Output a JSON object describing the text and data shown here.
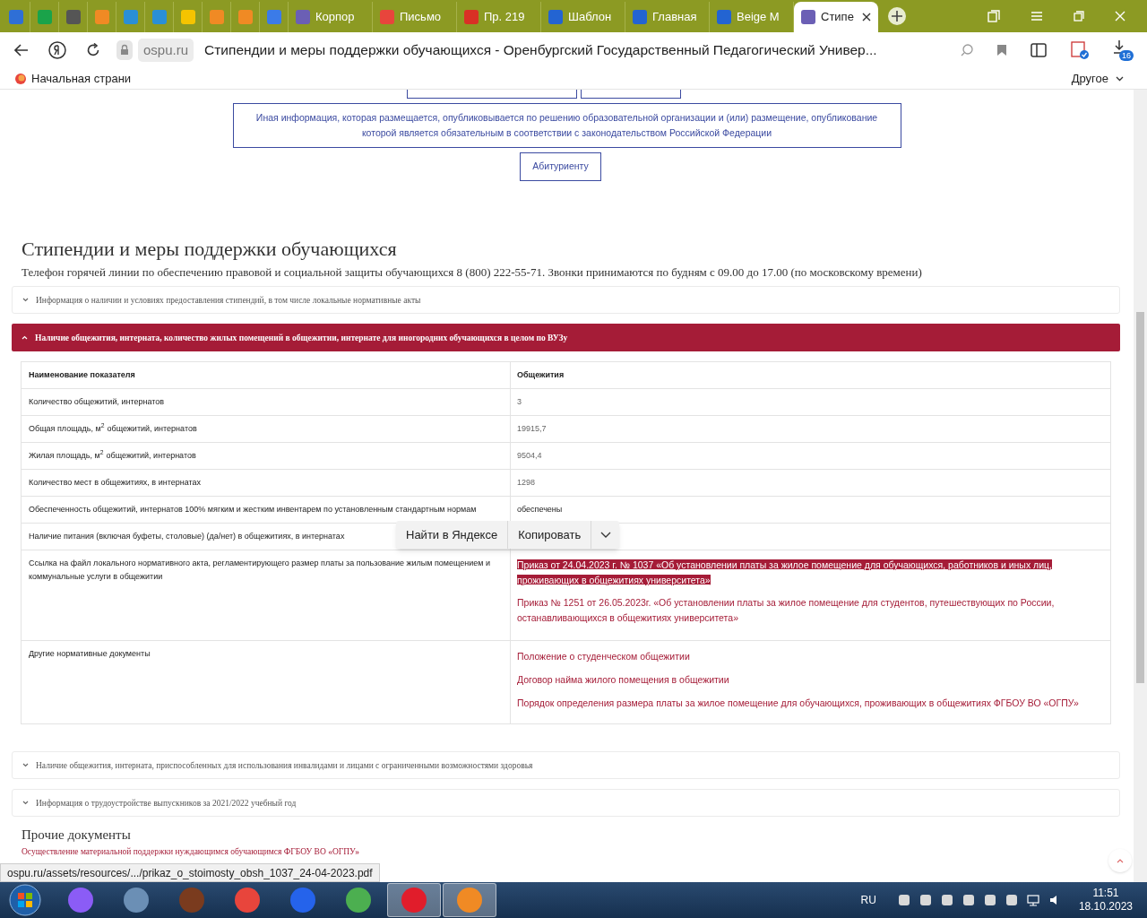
{
  "browser": {
    "tabs": [
      {
        "color": "#2f6fd6",
        "selected": false
      },
      {
        "color": "#1aa34a",
        "selected": false
      },
      {
        "color": "#555555",
        "selected": false
      },
      {
        "color": "#f08a24",
        "selected": false
      },
      {
        "color": "#2a8fd6",
        "selected": false
      },
      {
        "color": "#2a8fd6",
        "selected": false
      },
      {
        "color": "#f5c400",
        "selected": false
      },
      {
        "color": "#f08a24",
        "selected": false
      },
      {
        "color": "#f08a24",
        "selected": false
      },
      {
        "color": "#3b7be8",
        "selected": false
      },
      {
        "label": "Корпор",
        "color": "#6b5fb5",
        "selected": false
      },
      {
        "label": "Письмо",
        "color": "#e8453c",
        "selected": false
      },
      {
        "label": "Пр. 219",
        "color": "#d93025",
        "selected": false
      },
      {
        "label": "Шаблон",
        "color": "#2364d2",
        "selected": false
      },
      {
        "label": "Главная",
        "color": "#2364d2",
        "selected": false
      },
      {
        "label": "Beige M",
        "color": "#2364d2",
        "selected": false
      },
      {
        "label": "Стипе",
        "color": "#6b5fb5",
        "selected": true
      }
    ],
    "domain": "ospu.ru",
    "page_title": "Стипендии и меры поддержки обучающихся - Оренбургский Государственный Педагогический Универ...",
    "download_count": "16",
    "bookmarks": [
      {
        "label": "Начальная страни"
      }
    ],
    "bookmarks_other": "Другое"
  },
  "page": {
    "nav_links": [
      "Иная информация, которая размещается, опубликовывается по решению образовательной организации и (или) размещение, опубликование которой является обязательным в соответствии с законодательством Российской Федерации",
      "Абитуриенту"
    ],
    "heading": "Стипендии и меры поддержки обучающихся",
    "hotline": "Телефон горячей линии по обеспечению правовой и социальной защиты обучающихся 8 (800) 222-55-71. Звонки принимаются по будням с 09.00 до 17.00 (по московскому времени)",
    "accordions": [
      {
        "title": "Информация о наличии и условиях предоставления стипендий, в том числе локальные нормативные акты",
        "expanded": false
      },
      {
        "title": "Наличие общежития, интерната, количество жилых помещений в общежитии, интернате для иногородних обучающихся в целом по ВУЗу",
        "expanded": true
      },
      {
        "title": "Наличие общежития, интерната, приспособленных для использования инвалидами и лицами с ограниченными возможностями здоровья",
        "expanded": false
      },
      {
        "title": "Информация о трудоустройстве выпускников за 2021/2022 учебный год",
        "expanded": false
      }
    ],
    "table": {
      "columns": [
        "Наименование показателя",
        "Общежития"
      ],
      "rows": [
        {
          "name": "Количество общежитий, интернатов",
          "value": "3"
        },
        {
          "name": "Общая площадь, м$^{2}$ общежитий, интернатов",
          "value": "19915,7"
        },
        {
          "name": "Жилая площадь, м$^{2}$ общежитий, интернатов",
          "value": "9504,4"
        },
        {
          "name": "Количество мест в общежитиях, в интернатах",
          "value": "1298"
        },
        {
          "name": "Обеспеченность общежитий, интернатов 100% мягким и жестким инвентарем по установленным стандартным нормам",
          "value": "обеспечены"
        },
        {
          "name": "Наличие питания (включая буфеты, столовые) (да/нет) в общежитиях, в интернатах",
          "value": ""
        },
        {
          "name": "Ссылка на файл локального нормативного акта, регламентирующего размер платы за пользование жилым помещением и коммунальные услуги в общежитии",
          "links": [
            {
              "text": "Приказ от 24.04.2023 г. № 1037 «Об установлении платы за жилое помещение для обучающихся, работников и иных лиц, проживающих в общежитиях университета»",
              "highlighted": true
            },
            {
              "text": "Приказ № 1251 от 26.05.2023г. «Об установлении платы за жилое помещение для студентов, путешествующих по России, останавливающихся в общежитиях университета»",
              "highlighted": false
            }
          ]
        },
        {
          "name": "Другие нормативные документы",
          "links": [
            {
              "text": "Положение о студенческом общежитии",
              "highlighted": false
            },
            {
              "text": "Договор найма жилого помещения в общежитии",
              "highlighted": false
            },
            {
              "text": "Порядок определения размера платы за жилое помещение для обучающихся, проживающих в общежитиях ФГБОУ ВО «ОГПУ»",
              "highlighted": false
            }
          ]
        }
      ]
    },
    "context_menu": [
      "Найти в Яндексе",
      "Копировать"
    ],
    "other_heading": "Прочие документы",
    "other_links": [
      "Осуществление материальной поддержки нуждающимся обучающимся ФГБОУ ВО «ОГПУ»"
    ]
  },
  "status_url": "ospu.ru/assets/resources/.../prikaz_o_stoimosty_obsh_1037_24-04-2023.pdf",
  "taskbar": {
    "apps": [
      {
        "color": "#8b5cf6",
        "active": false
      },
      {
        "color": "#6b8fb5",
        "active": false
      },
      {
        "color": "#7a3b1e",
        "active": false
      },
      {
        "color": "#e8453c",
        "active": false
      },
      {
        "color": "#2563eb",
        "active": false
      },
      {
        "color": "#4caf50",
        "active": false
      },
      {
        "color": "#e11d2b",
        "active": true
      },
      {
        "color": "#f08a24",
        "active": true
      }
    ],
    "language": "RU",
    "time": "11:51",
    "date": "18.10.2023"
  }
}
